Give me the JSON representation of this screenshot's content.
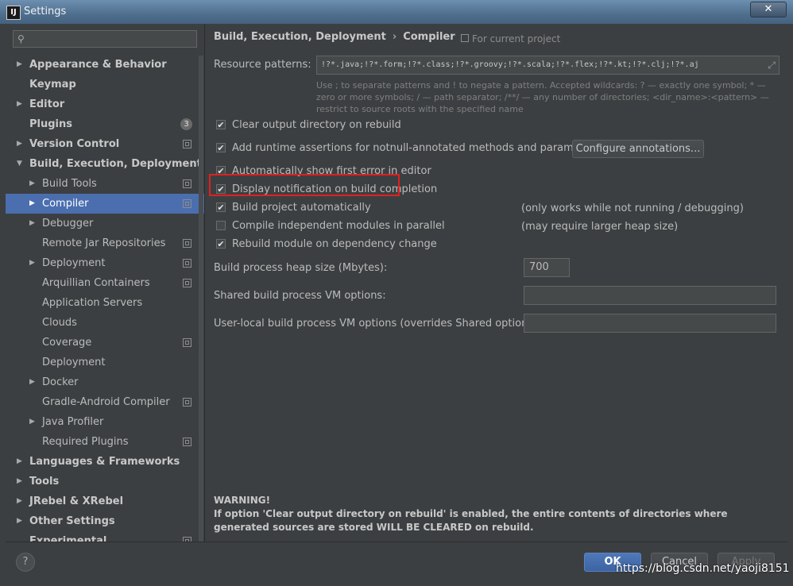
{
  "window": {
    "title": "Settings",
    "app_icon_text": "IJ",
    "close_glyph": "✕"
  },
  "sidebar": {
    "search_placeholder": "",
    "items": [
      {
        "label": "Appearance & Behavior",
        "level": 0,
        "arrow": "▶"
      },
      {
        "label": "Keymap",
        "level": 0
      },
      {
        "label": "Editor",
        "level": 0,
        "arrow": "▶"
      },
      {
        "label": "Plugins",
        "level": 0,
        "badge": "3"
      },
      {
        "label": "Version Control",
        "level": 0,
        "arrow": "▶",
        "project": true
      },
      {
        "label": "Build, Execution, Deployment",
        "level": 0,
        "arrow": "▼"
      },
      {
        "label": "Build Tools",
        "level": 1,
        "arrow": "▶",
        "project": true
      },
      {
        "label": "Compiler",
        "level": 1,
        "arrow": "▶",
        "project": true,
        "selected": true
      },
      {
        "label": "Debugger",
        "level": 1,
        "arrow": "▶"
      },
      {
        "label": "Remote Jar Repositories",
        "level": 1,
        "project": true
      },
      {
        "label": "Deployment",
        "level": 1,
        "arrow": "▶",
        "project": true
      },
      {
        "label": "Arquillian Containers",
        "level": 1,
        "project": true
      },
      {
        "label": "Application Servers",
        "level": 1
      },
      {
        "label": "Clouds",
        "level": 1
      },
      {
        "label": "Coverage",
        "level": 1,
        "project": true
      },
      {
        "label": "Deployment",
        "level": 1
      },
      {
        "label": "Docker",
        "level": 1,
        "arrow": "▶"
      },
      {
        "label": "Gradle-Android Compiler",
        "level": 1,
        "project": true
      },
      {
        "label": "Java Profiler",
        "level": 1,
        "arrow": "▶"
      },
      {
        "label": "Required Plugins",
        "level": 1,
        "project": true
      },
      {
        "label": "Languages & Frameworks",
        "level": 0,
        "arrow": "▶"
      },
      {
        "label": "Tools",
        "level": 0,
        "arrow": "▶"
      },
      {
        "label": "JRebel & XRebel",
        "level": 0,
        "arrow": "▶"
      },
      {
        "label": "Other Settings",
        "level": 0,
        "arrow": "▶"
      },
      {
        "label": "Experimental",
        "level": 0,
        "project": true
      }
    ]
  },
  "content": {
    "breadcrumb": {
      "parent": "Build, Execution, Deployment",
      "separator": "›",
      "current": "Compiler"
    },
    "for_project": "For current project",
    "resource_patterns": {
      "label": "Resource patterns:",
      "value": "!?*.java;!?*.form;!?*.class;!?*.groovy;!?*.scala;!?*.flex;!?*.kt;!?*.clj;!?*.aj",
      "expand_glyph": "⤢",
      "hint": "Use ; to separate patterns and ! to negate a pattern. Accepted wildcards: ? — exactly one symbol; * — zero or more symbols; / — path separator; /**/ — any number of directories; <dir_name>:<pattern> — restrict to source roots with the specified name"
    },
    "options": {
      "clear_output": {
        "label": "Clear output directory on rebuild",
        "checked": "✔"
      },
      "runtime_assertions": {
        "label": "Add runtime assertions for notnull-annotated methods and parameters",
        "checked": "✔"
      },
      "configure_annotations": "Configure annotations...",
      "show_first_error": {
        "label": "Automatically show first error in editor",
        "checked": "✔"
      },
      "display_notification": {
        "label": "Display notification on build completion",
        "checked": "✔"
      },
      "build_automatically": {
        "label": "Build project automatically",
        "checked": "✔",
        "note": "(only works while not running / debugging)"
      },
      "compile_parallel": {
        "label": "Compile independent modules in parallel",
        "checked": "",
        "note": "(may require larger heap size)"
      },
      "rebuild_on_change": {
        "label": "Rebuild module on dependency change",
        "checked": "✔"
      }
    },
    "heap_size": {
      "label": "Build process heap size (Mbytes):",
      "value": "700"
    },
    "shared_vm": {
      "label": "Shared build process VM options:",
      "value": ""
    },
    "user_vm": {
      "label": "User-local build process VM options (overrides Shared options):",
      "value": ""
    },
    "warning": {
      "title": "WARNING!",
      "text": "If option 'Clear output directory on rebuild' is enabled, the entire contents of directories where generated sources are stored WILL BE CLEARED on rebuild."
    }
  },
  "footer": {
    "help": "?",
    "ok": "OK",
    "cancel": "Cancel",
    "apply": "Apply"
  },
  "watermark": "https://blog.csdn.net/yaoji8151",
  "colors": {
    "selection": "#4b6eaf",
    "background": "#3c3f41",
    "highlight_box": "#e02020"
  }
}
